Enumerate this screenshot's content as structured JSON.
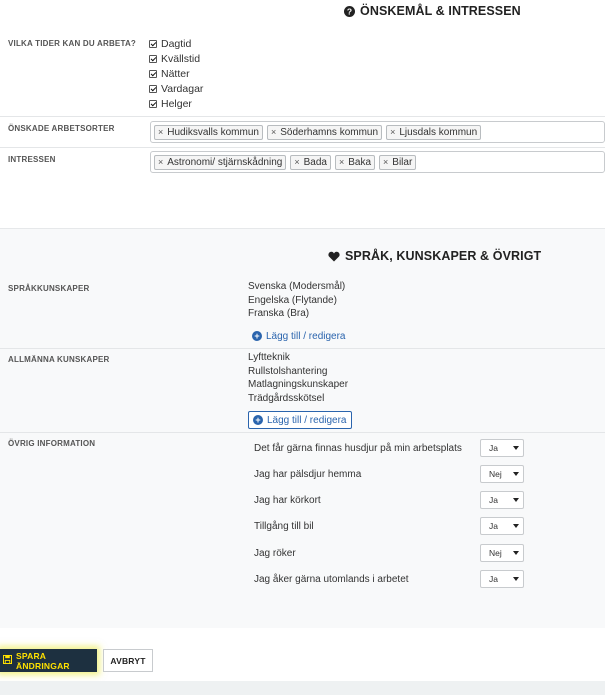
{
  "wishes": {
    "heading": "ÖNSKEMÅL & INTRESSEN",
    "heading_icon": "question-circle-icon",
    "work_times": {
      "label": "VILKA TIDER KAN DU ARBETA?",
      "options": [
        {
          "label": "Dagtid",
          "checked": true
        },
        {
          "label": "Kvällstid",
          "checked": true
        },
        {
          "label": "Nätter",
          "checked": true
        },
        {
          "label": "Vardagar",
          "checked": true
        },
        {
          "label": "Helger",
          "checked": true
        }
      ]
    },
    "locations": {
      "label": "ÖNSKADE ARBETSORTER",
      "tags": [
        "Hudiksvalls kommun",
        "Söderhamns kommun",
        "Ljusdals kommun"
      ]
    },
    "interests": {
      "label": "INTRESSEN",
      "tags": [
        "Astronomi/ stjärnskådning",
        "Bada",
        "Baka",
        "Bilar"
      ]
    }
  },
  "skills": {
    "heading": "SPRÅK, KUNSKAPER & ÖVRIGT",
    "heading_icon": "heart-icon",
    "languages": {
      "label": "SPRÅKKUNSKAPER",
      "items": [
        "Svenska (Modersmål)",
        "Engelska (Flytande)",
        "Franska (Bra)"
      ],
      "link": "Lägg till / redigera"
    },
    "general": {
      "label": "ALLMÄNNA KUNSKAPER",
      "items": [
        "Lyftteknik",
        "Rullstolshantering",
        "Matlagningskunskaper",
        "Trädgårdsskötsel"
      ],
      "link": "Lägg till / redigera"
    },
    "other": {
      "label": "ÖVRIG INFORMATION",
      "rows": [
        {
          "question": "Det får gärna finnas husdjur på min arbetsplats",
          "value": "Ja"
        },
        {
          "question": "Jag har pälsdjur hemma",
          "value": "Nej"
        },
        {
          "question": "Jag har körkort",
          "value": "Ja"
        },
        {
          "question": "Tillgång till bil",
          "value": "Ja"
        },
        {
          "question": "Jag röker",
          "value": "Nej"
        },
        {
          "question": "Jag åker gärna utomlands i arbetet",
          "value": "Ja"
        }
      ]
    }
  },
  "actions": {
    "save": "SPARA ÄNDRINGAR",
    "save_icon": "floppy-disk-icon",
    "cancel": "AVBRYT"
  },
  "colors": {
    "save_bg": "#1d3040",
    "save_text": "#ffe100",
    "link": "#2a64ad"
  }
}
